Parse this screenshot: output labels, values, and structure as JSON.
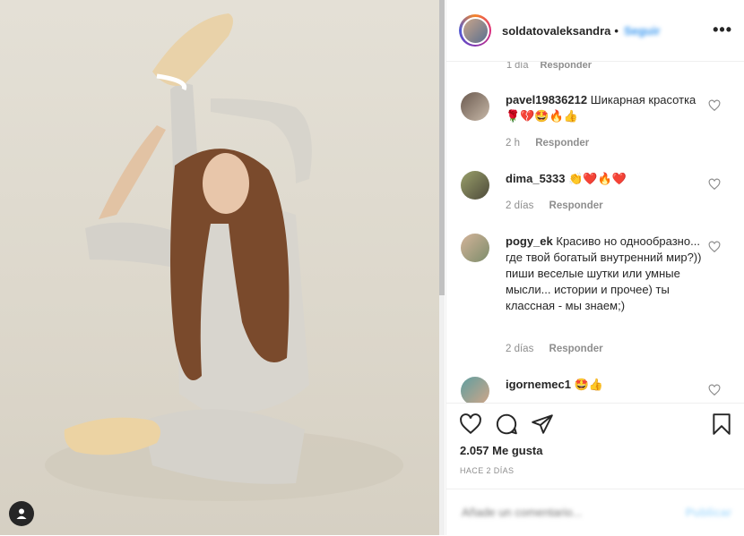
{
  "header": {
    "username": "soldatovaleksandra",
    "separator": "•",
    "follow_label": "Seguir",
    "more_label": "•••"
  },
  "comments": {
    "top_meta": {
      "time": "1 día",
      "reply_label": "Responder"
    },
    "items": [
      {
        "user": "pavel19836212",
        "text": "Шикарная красотка🌹💔🤩🔥👍",
        "time": "2 h",
        "reply_label": "Responder"
      },
      {
        "user": "dima_5333",
        "text": "👏❤️🔥❤️",
        "time": "2 días",
        "reply_label": "Responder"
      },
      {
        "user": "pogy_ek",
        "text": "Красиво но однообразно... где твой богатый внутренний мир?)) пиши веселые шутки или умные мысли... истории и прочее) ты классная - мы знаем;)",
        "time": "2 días",
        "reply_label": "Responder"
      },
      {
        "user": "igornemec1",
        "text": "🤩👍",
        "time": "",
        "reply_label": ""
      }
    ]
  },
  "actions": {
    "likes_text": "2.057 Me gusta",
    "posted_time": "HACE 2 DÍAS",
    "icons": [
      "heart-icon",
      "comment-icon",
      "share-icon",
      "bookmark-icon"
    ]
  },
  "add_comment": {
    "placeholder": "Añade un comentario...",
    "publish_label": "Publicar"
  },
  "colors": {
    "link_blue": "#3897f0",
    "muted": "#8e8e8e",
    "text": "#262626"
  }
}
